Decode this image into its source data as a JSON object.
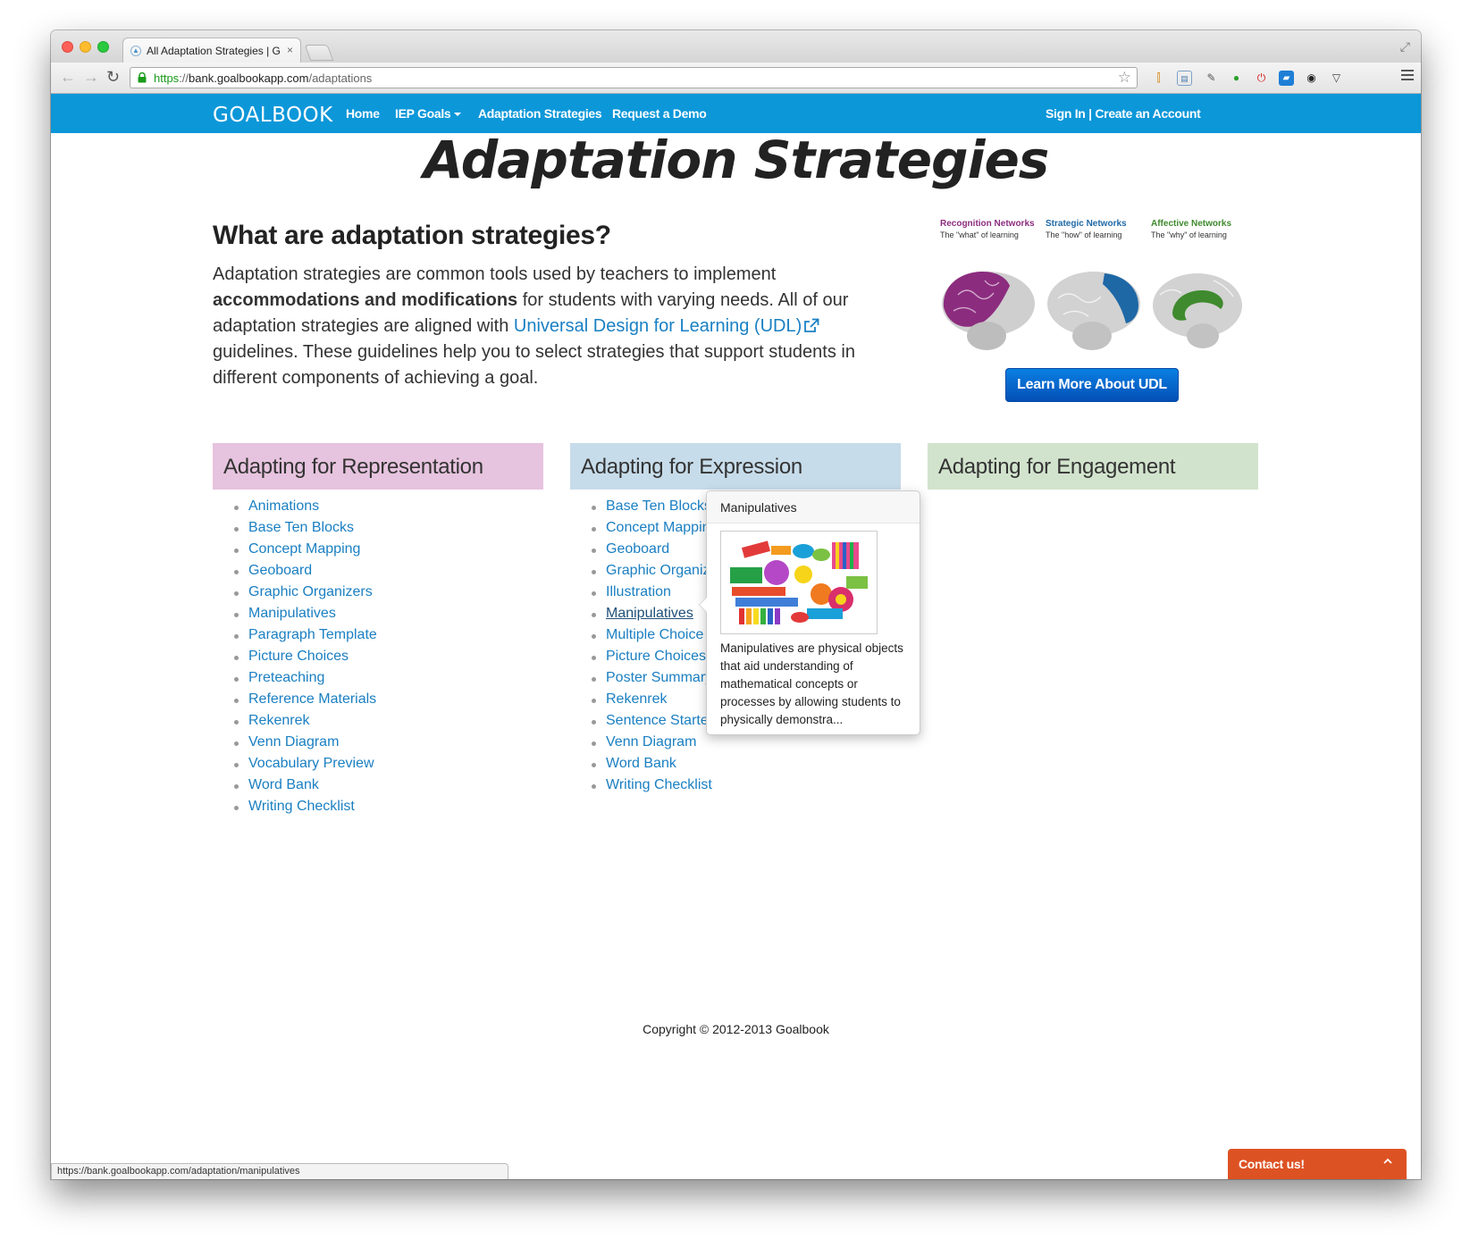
{
  "browser": {
    "tab_title": "All Adaptation Strategies | G",
    "tab_close": "×",
    "url_scheme": "https",
    "url_host": "bank.goalbookapp.com",
    "url_path": "/adaptations",
    "status_url": "https://bank.goalbookapp.com/adaptation/manipulatives"
  },
  "nav": {
    "logo": "GOALBOOK",
    "home": "Home",
    "iep_goals": "IEP Goals",
    "adaptation_strategies": "Adaptation Strategies",
    "request_demo": "Request a Demo",
    "signin": "Sign In | Create an Account"
  },
  "page": {
    "title": "Adaptation Strategies",
    "intro_heading": "What are adaptation strategies?",
    "intro_part1": "Adaptation strategies are common tools used by teachers to implement ",
    "intro_bold": "accommodations and modifications",
    "intro_part2": " for students with varying needs. All of our adaptation strategies are aligned with ",
    "intro_link": "Universal Design for Learning (UDL)",
    "intro_part3": " guidelines. These guidelines help you to select strategies that support students in different components of achieving a goal.",
    "udl_button": "Learn More About UDL",
    "copyright": "Copyright © 2012-2013 Goalbook"
  },
  "brains": [
    {
      "title": "Recognition Networks",
      "sub": "The \"what\" of learning",
      "color": "#8c2c7f"
    },
    {
      "title": "Strategic Networks",
      "sub": "The \"how\" of learning",
      "color": "#1e68a6"
    },
    {
      "title": "Affective Networks",
      "sub": "The \"why\" of learning",
      "color": "#3f8a2e"
    }
  ],
  "columns": {
    "representation": {
      "heading": "Adapting for Representation",
      "items": [
        "Animations",
        "Base Ten Blocks",
        "Concept Mapping",
        "Geoboard",
        "Graphic Organizers",
        "Manipulatives",
        "Paragraph Template",
        "Picture Choices",
        "Preteaching",
        "Reference Materials",
        "Rekenrek",
        "Venn Diagram",
        "Vocabulary Preview",
        "Word Bank",
        "Writing Checklist"
      ]
    },
    "expression": {
      "heading": "Adapting for Expression",
      "items": [
        "Base Ten Blocks",
        "Concept Mapping",
        "Geoboard",
        "Graphic Organizers",
        "Illustration",
        "Manipulatives",
        "Multiple Choice",
        "Picture Choices",
        "Poster Summary",
        "Rekenrek",
        "Sentence Starters",
        "Venn Diagram",
        "Word Bank",
        "Writing Checklist"
      ]
    },
    "engagement": {
      "heading": "Adapting for Engagement",
      "items": []
    }
  },
  "popover": {
    "title": "Manipulatives",
    "text": "Manipulatives are physical objects that aid understanding of mathematical concepts or processes by allowing students to physically demonstra..."
  },
  "contact": {
    "label": "Contact us!"
  },
  "colors": {
    "nav_blue": "#0c97d9",
    "link_blue": "#1a7fc2",
    "rep_head": "#e6c3de",
    "exp_head": "#c7dcea",
    "eng_head": "#d2e3cd",
    "contact_orange": "#dd5223"
  }
}
